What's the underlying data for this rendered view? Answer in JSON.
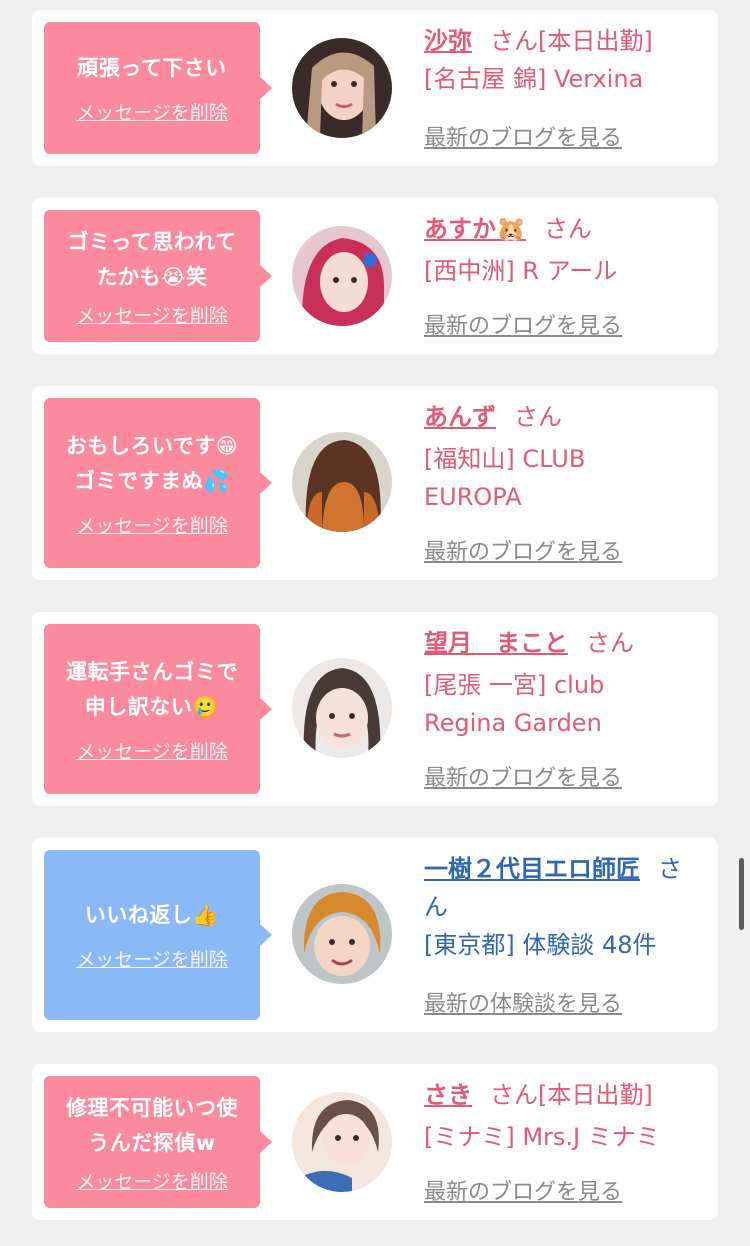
{
  "delete_label": "メッセージを削除",
  "cards": [
    {
      "message": "頑張って下さい",
      "name": "沙弥",
      "suffix": "さん[本日出勤]",
      "shop_line1": "[名古屋 錦] Verxina",
      "shop_line2": "",
      "link": "最新のブログを見る",
      "theme": "pink"
    },
    {
      "message": "ゴミって思われて\nたかも😭笑",
      "name": "あすか🐹",
      "suffix": "さん",
      "shop_line1": "[西中洲] R アール",
      "shop_line2": "",
      "link": "最新のブログを見る",
      "theme": "pink"
    },
    {
      "message": "おもしろいです😁\nゴミですまぬ💦",
      "name": "あんず",
      "suffix": "さん",
      "shop_line1": "[福知山] CLUB",
      "shop_line2": "EUROPA",
      "link": "最新のブログを見る",
      "theme": "pink"
    },
    {
      "message": "運転手さんゴミで\n申し訳ない🥲",
      "name": "望月　まこと",
      "suffix": "さん",
      "shop_line1": "[尾張 一宮] club",
      "shop_line2": "Regina Garden",
      "link": "最新のブログを見る",
      "theme": "pink"
    },
    {
      "message": "いいね返し👍",
      "name": "一樹２代目エロ師匠",
      "suffix": "さ",
      "suffix2": "ん",
      "shop_line1": "[東京都] 体験談 48件",
      "shop_line2": "",
      "link": "最新の体験談を見る",
      "theme": "blue"
    },
    {
      "message": "修理不可能いつ使\nうんだ探偵w",
      "name": "さき",
      "suffix": "さん[本日出勤]",
      "shop_line1": "[ミナミ] Mrs.J ミナミ",
      "shop_line2": "",
      "link": "最新のブログを見る",
      "theme": "pink"
    }
  ]
}
